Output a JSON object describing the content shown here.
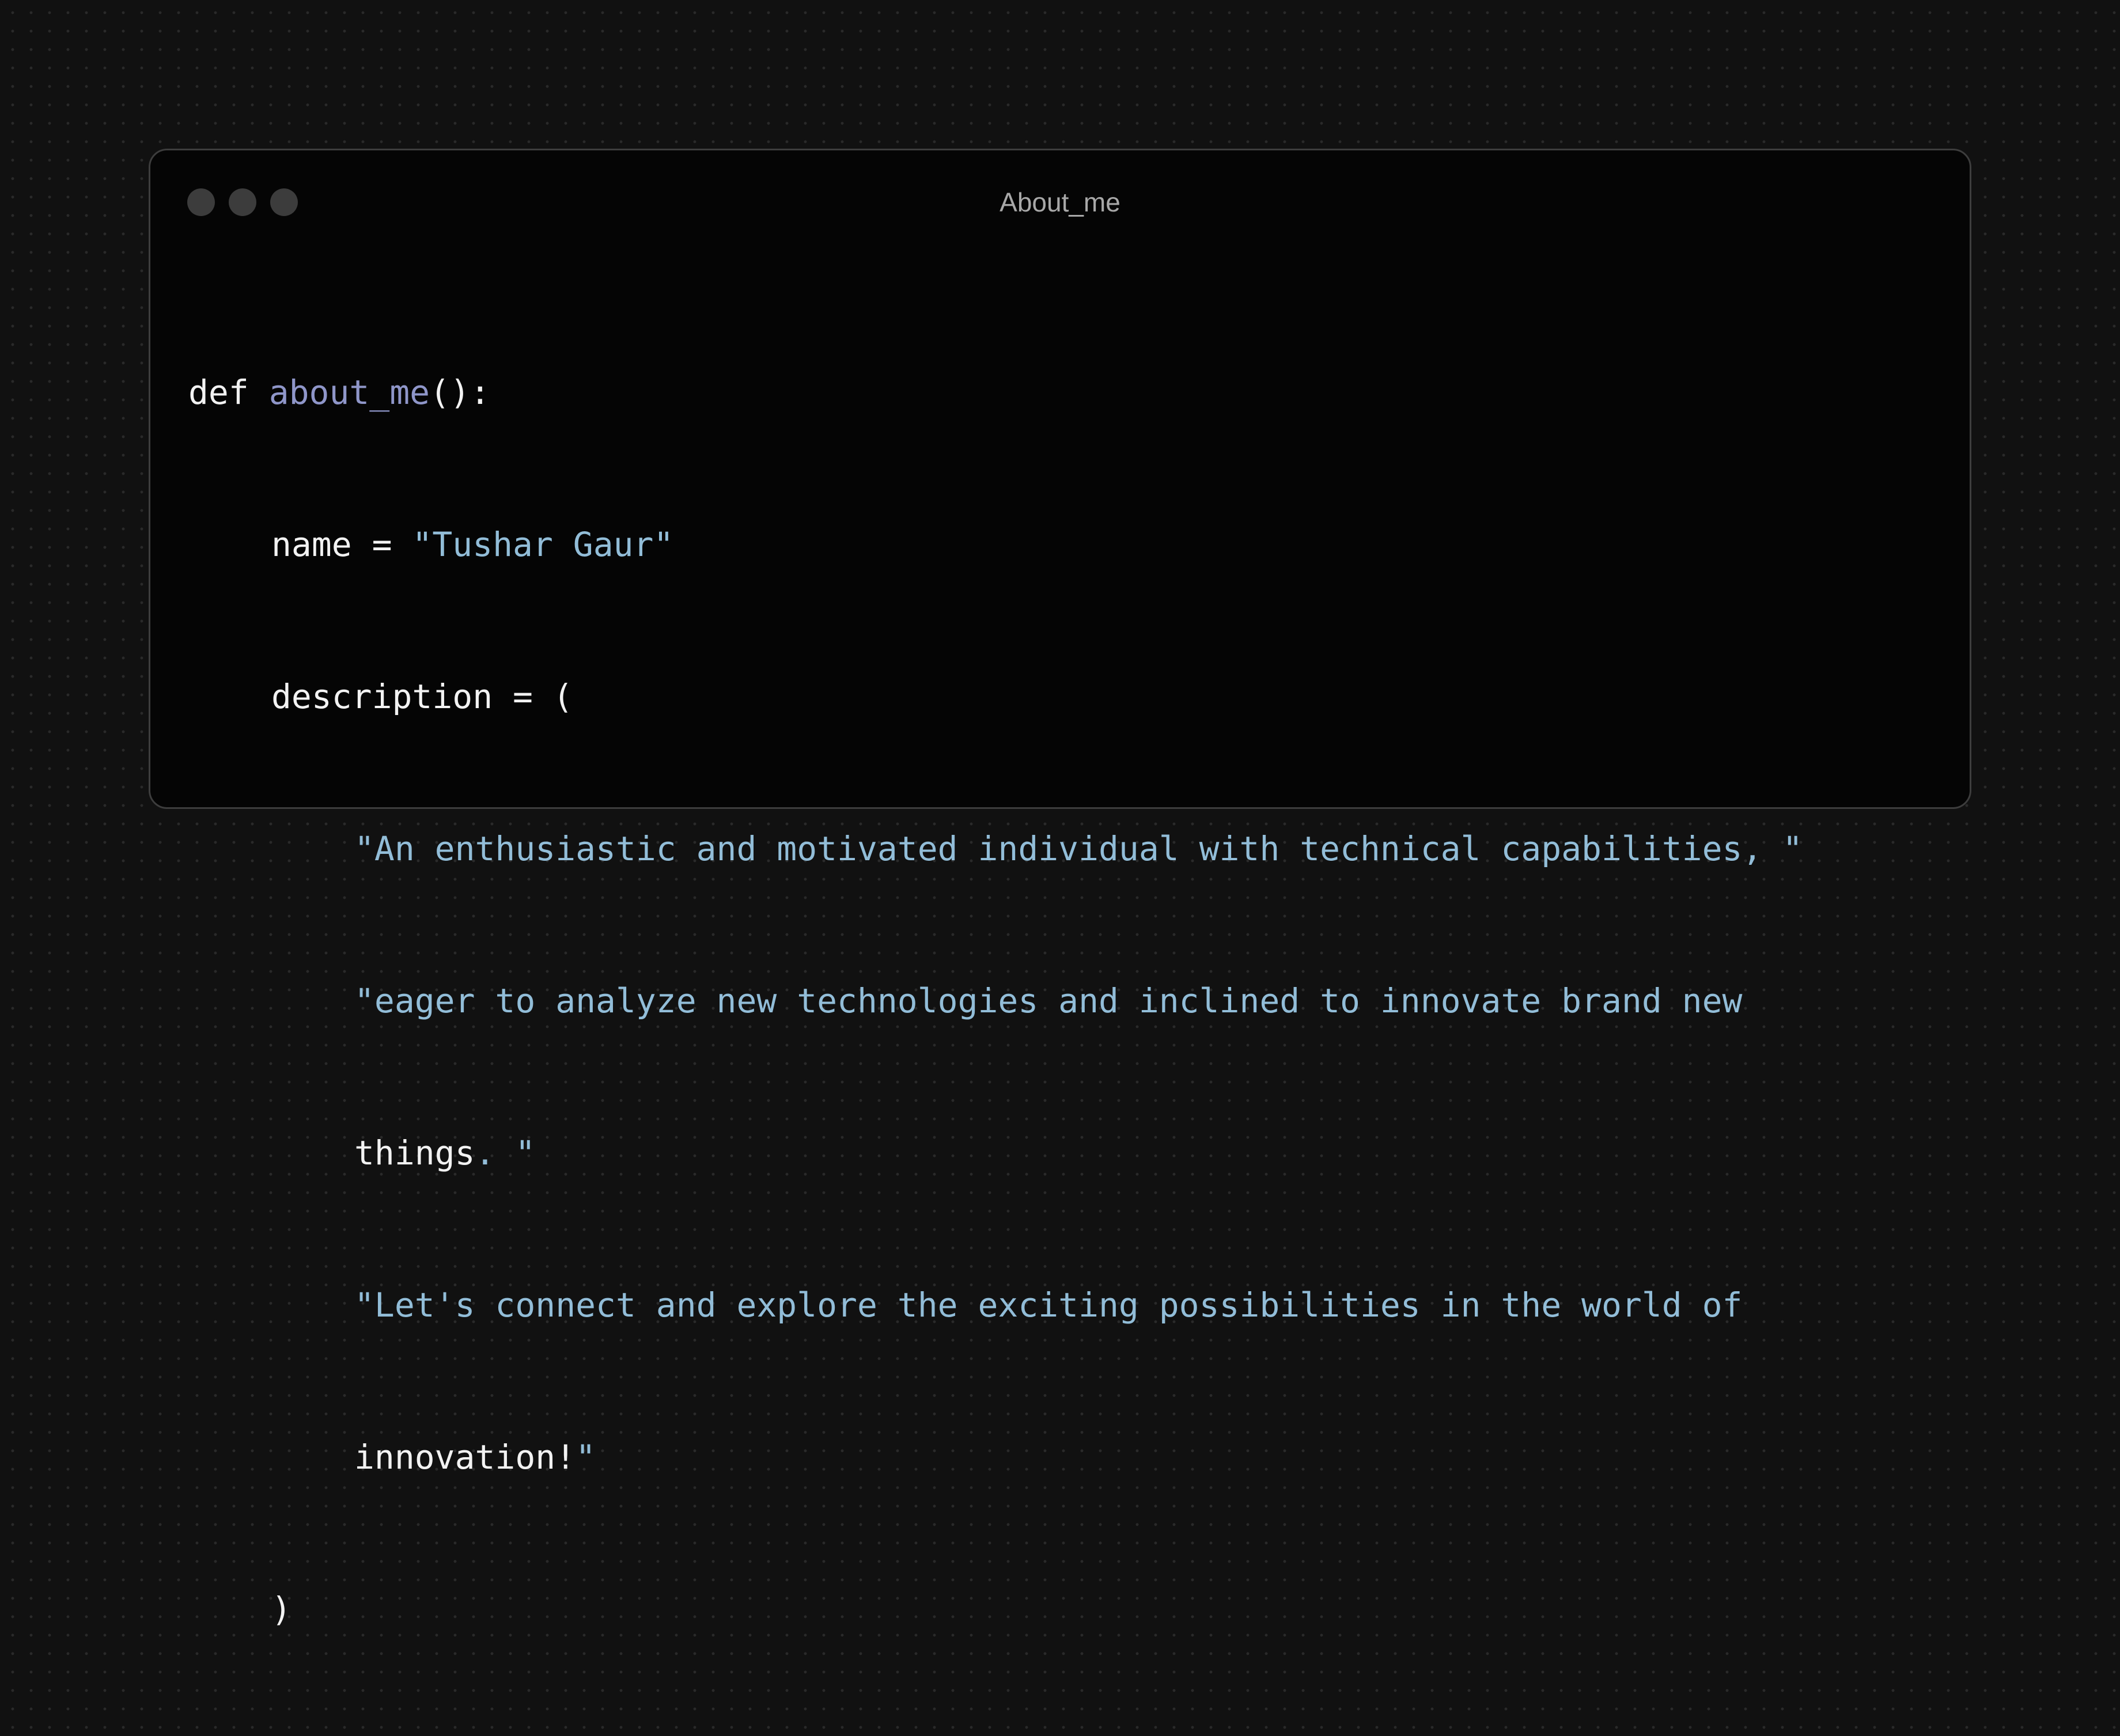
{
  "window": {
    "title": "About_me"
  },
  "code": {
    "keyword_def": "def",
    "function_name": "about_me",
    "signature_tail": "():",
    "name_assign": "name = ",
    "name_value": "\"Tushar Gaur\"",
    "description_assign": "description = (",
    "line1": "\"An enthusiastic and motivated individual with technical capabilities, \"",
    "line2": "\"eager to analyze new technologies and inclined to innovate brand new",
    "line3_word": "things",
    "line3_tail": ". \"",
    "line4": "\"Let's connect and explore the exciting possibilities in the world of",
    "line5_word": "innovation!",
    "line5_quote": "\"",
    "close_paren": ")"
  },
  "colors": {
    "background": "#111111",
    "window": "#050505",
    "text": "#f2f2f2",
    "function": "#8f96c9",
    "string": "#92bdd8"
  }
}
